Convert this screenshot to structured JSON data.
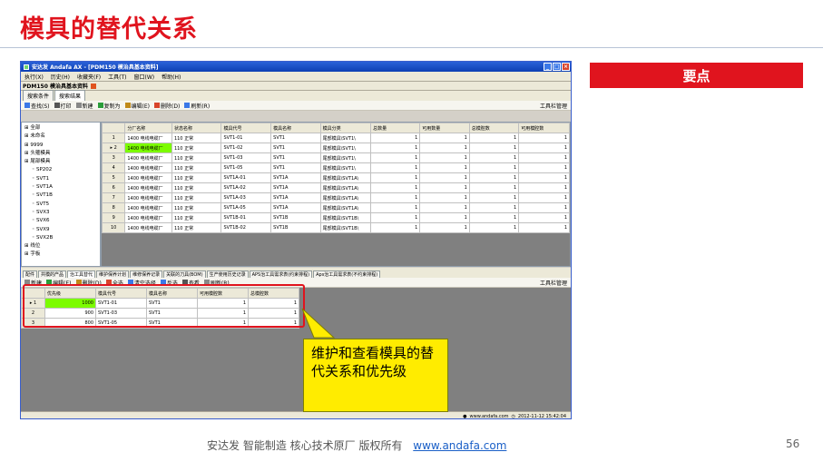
{
  "slide": {
    "title": "模具的替代关系",
    "keypoint": "要点",
    "callout": "维护和查看模具的替代关系和优先级",
    "footer_text": "安达发  智能制造 核心技术原厂  版权所有",
    "footer_link": "www.andafa.com",
    "page_number": "56"
  },
  "window": {
    "title": "安达发 Andafa AX - [PDM150 模治具基本资料]",
    "menu": [
      "执行(X)",
      "历史(H)",
      "收藏夹(F)",
      "工具(T)",
      "窗口(W)",
      "帮助(H)"
    ],
    "form_title": "PDM150 模治具基本资料",
    "tabs": [
      "搜索条件",
      "搜索结果"
    ],
    "toolbar": [
      "查找(S)",
      "打印",
      "新建",
      "复制为",
      "编辑(E)",
      "删除(D)",
      "刷新(R)"
    ],
    "toolbar_right": "工具栏管理",
    "tree": [
      "全部",
      "未命名",
      "9999",
      "头箍模具",
      "尾部模具",
      "SP202",
      "SVT1",
      "SVT1A",
      "SVT1B",
      "SVT5",
      "SVX3",
      "SVX6",
      "SVX9",
      "SVX2B",
      "线位",
      "字板"
    ],
    "upper_columns": [
      "分厂名称",
      "状态名称",
      "模具代号",
      "模具名称",
      "模具分类",
      "总数量",
      "可用数量",
      "总模腔数",
      "可用模腔数"
    ],
    "upper_rows": [
      [
        "1400 电线电缆厂",
        "110 正常",
        "SVT1-01",
        "SVT1",
        "尾部模具\\SVT1\\",
        "1",
        "1",
        "1",
        "1"
      ],
      [
        "1400 电线电缆厂",
        "110 正常",
        "SVT1-02",
        "SVT1",
        "尾部模具\\SVT1\\",
        "1",
        "1",
        "1",
        "1"
      ],
      [
        "1400 电线电缆厂",
        "110 正常",
        "SVT1-03",
        "SVT1",
        "尾部模具\\SVT1\\",
        "1",
        "1",
        "1",
        "1"
      ],
      [
        "1400 电线电缆厂",
        "110 正常",
        "SVT1-05",
        "SVT1",
        "尾部模具\\SVT1\\",
        "1",
        "1",
        "1",
        "1"
      ],
      [
        "1400 电线电缆厂",
        "110 正常",
        "SVT1A-01",
        "SVT1A",
        "尾部模具\\SVT1A\\",
        "1",
        "1",
        "1",
        "1"
      ],
      [
        "1400 电线电缆厂",
        "110 正常",
        "SVT1A-02",
        "SVT1A",
        "尾部模具\\SVT1A\\",
        "1",
        "1",
        "1",
        "1"
      ],
      [
        "1400 电线电缆厂",
        "110 正常",
        "SVT1A-03",
        "SVT1A",
        "尾部模具\\SVT1A\\",
        "1",
        "1",
        "1",
        "1"
      ],
      [
        "1400 电线电缆厂",
        "110 正常",
        "SVT1A-05",
        "SVT1A",
        "尾部模具\\SVT1A\\",
        "1",
        "1",
        "1",
        "1"
      ],
      [
        "1400 电线电缆厂",
        "110 正常",
        "SVT1B-01",
        "SVT1B",
        "尾部模具\\SVT1B\\",
        "1",
        "1",
        "1",
        "1"
      ],
      [
        "1400 电线电缆厂",
        "110 正常",
        "SVT1B-02",
        "SVT1B",
        "尾部模具\\SVT1B\\",
        "1",
        "1",
        "1",
        "1"
      ]
    ],
    "lower_tabs": [
      "配件",
      "共模的产品",
      "治工具替代",
      "维护保养计划",
      "维修保养记录",
      "关联的刀具(BOM)",
      "生产使用历史记录",
      "APS治工具需求表(约束排程)",
      "Aps治工具需求表(不约束排程)"
    ],
    "lower_toolbar": [
      "新建",
      "编辑(E)",
      "删除(D)",
      "全选",
      "清空选择",
      "反选",
      "查看",
      "刷新(R)"
    ],
    "lower_columns": [
      "优先级",
      "模具代号",
      "模具名称",
      "可用模腔数",
      "总模腔数"
    ],
    "lower_rows": [
      [
        "1000",
        "SVT1-01",
        "SVT1",
        "1",
        "1"
      ],
      [
        "900",
        "SVT1-03",
        "SVT1",
        "1",
        "1"
      ],
      [
        "800",
        "SVT1-05",
        "SVT1",
        "1",
        "1"
      ]
    ],
    "status_text": "www.andafa.com",
    "status_time": "2012-11-12 15:42:04"
  },
  "colors": {
    "accent": "#e0141e",
    "callout": "#ffec00",
    "selected_cell": "#7cfc00"
  }
}
